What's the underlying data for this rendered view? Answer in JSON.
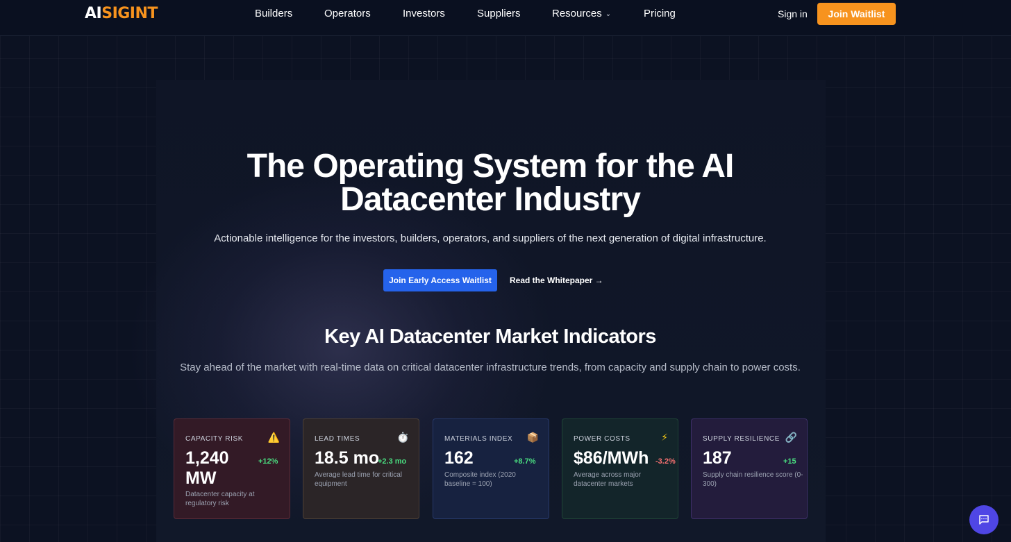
{
  "nav": {
    "logo_ai": "AI",
    "logo_sig": "SIGINT",
    "links": [
      {
        "label": "Builders"
      },
      {
        "label": "Operators"
      },
      {
        "label": "Investors"
      },
      {
        "label": "Suppliers"
      },
      {
        "label": "Resources",
        "has_dropdown": true
      },
      {
        "label": "Pricing"
      }
    ],
    "sign_in": "Sign in",
    "join_waitlist": "Join Waitlist"
  },
  "hero": {
    "headline_line1": "The Operating System for the AI",
    "headline_line2": "Datacenter Industry",
    "subheadline": "Actionable intelligence for the investors, builders, operators, and suppliers of the next generation of digital infrastructure.",
    "cta_primary": "Join Early Access Waitlist",
    "cta_secondary": "Read the Whitepaper →"
  },
  "indicators": {
    "title": "Key AI Datacenter Market Indicators",
    "description": "Stay ahead of the market with real-time data on critical datacenter infrastructure trends, from capacity and supply chain to power costs.",
    "cards": [
      {
        "label": "CAPACITY RISK",
        "icon": "warning-icon",
        "glyph": "⚠️",
        "value": "1,240 MW",
        "change": "+12%",
        "trend": "positive",
        "caption": "Datacenter capacity at regulatory risk"
      },
      {
        "label": "LEAD TIMES",
        "icon": "stopwatch-icon",
        "glyph": "⏱️",
        "value": "18.5 mo",
        "change": "+2.3 mo",
        "trend": "positive",
        "caption": "Average lead time for critical equipment"
      },
      {
        "label": "MATERIALS INDEX",
        "icon": "package-icon",
        "glyph": "📦",
        "value": "162",
        "change": "+8.7%",
        "trend": "positive",
        "caption": "Composite index (2020 baseline = 100)"
      },
      {
        "label": "POWER COSTS",
        "icon": "lightning-icon",
        "glyph": "⚡",
        "value": "$86/MWh",
        "change": "-3.2%",
        "trend": "negative",
        "caption": "Average across major datacenter markets"
      },
      {
        "label": "SUPPLY RESILIENCE",
        "icon": "link-icon",
        "glyph": "🔗",
        "value": "187",
        "change": "+15",
        "trend": "positive",
        "caption": "Supply chain resilience score (0-300)"
      }
    ]
  },
  "colors": {
    "accent_orange": "#f7931e",
    "primary_blue": "#2563eb",
    "chat_purple": "#4f46e5",
    "positive_green": "#4ade80",
    "negative_red": "#f87171"
  }
}
